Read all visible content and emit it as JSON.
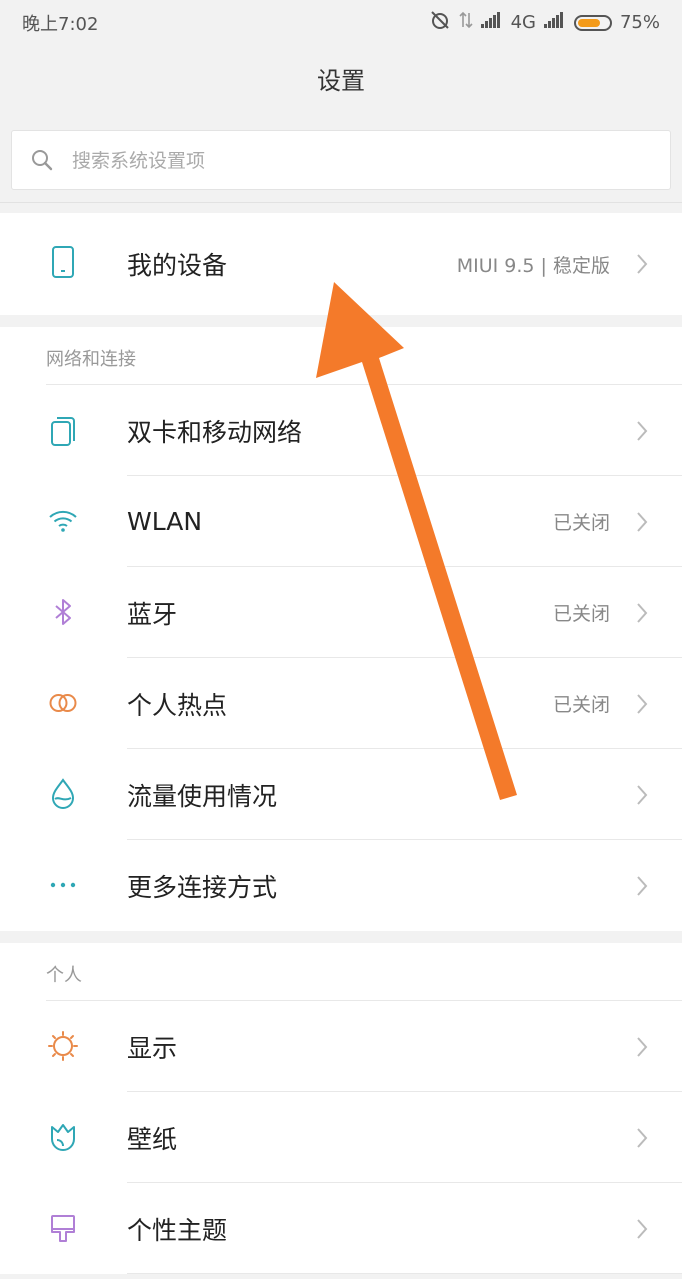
{
  "status_bar": {
    "time": "晚上7:02",
    "network": "4G",
    "battery_percent_text": "75%",
    "battery_level": 0.75,
    "battery_color": "#f49b1a"
  },
  "header": {
    "title": "设置"
  },
  "search": {
    "placeholder": "搜索系统设置项",
    "value": ""
  },
  "device": {
    "label": "我的设备",
    "value": "MIUI 9.5 | 稳定版",
    "icon": "phone-icon"
  },
  "sections": [
    {
      "header": "网络和连接",
      "items": [
        {
          "label": "双卡和移动网络",
          "value": "",
          "icon": "dual-sim-icon"
        },
        {
          "label": "WLAN",
          "value": "已关闭",
          "icon": "wifi-icon"
        },
        {
          "label": "蓝牙",
          "value": "已关闭",
          "icon": "bluetooth-icon"
        },
        {
          "label": "个人热点",
          "value": "已关闭",
          "icon": "hotspot-icon"
        },
        {
          "label": "流量使用情况",
          "value": "",
          "icon": "data-usage-icon"
        },
        {
          "label": "更多连接方式",
          "value": "",
          "icon": "more-connections-icon"
        }
      ]
    },
    {
      "header": "个人",
      "items": [
        {
          "label": "显示",
          "value": "",
          "icon": "display-icon"
        },
        {
          "label": "壁纸",
          "value": "",
          "icon": "wallpaper-icon"
        },
        {
          "label": "个性主题",
          "value": "",
          "icon": "theme-icon"
        }
      ]
    }
  ],
  "colors": {
    "annotation_arrow": "#f47a2a",
    "icon_teal": "#2fa7b5",
    "icon_purple": "#b07fd6",
    "icon_orange": "#e98a4a"
  }
}
